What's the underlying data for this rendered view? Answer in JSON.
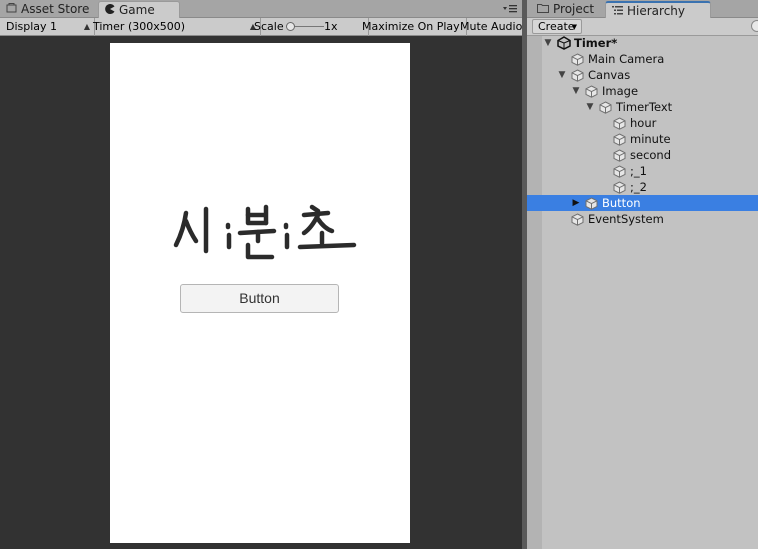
{
  "left_tabs": [
    {
      "label": "Asset Store",
      "icon": "store-icon"
    },
    {
      "label": "Game",
      "icon": "game-pacman-icon"
    }
  ],
  "right_tabs": [
    {
      "label": "Project",
      "icon": "folder-icon"
    },
    {
      "label": "Hierarchy",
      "icon": "list-icon"
    }
  ],
  "game_toolbar": {
    "display": "Display 1",
    "resolution": "Timer (300x500)",
    "scale_label": "Scale",
    "scale_value": "1x",
    "maximize": "Maximize On Play",
    "mute": "Mute Audio"
  },
  "game_view": {
    "button_label": "Button",
    "handwritten_text": "시:분:초"
  },
  "hierarchy": {
    "create_label": "Create",
    "items": [
      {
        "label": "Timer*"
      },
      {
        "label": "Main Camera"
      },
      {
        "label": "Canvas"
      },
      {
        "label": "Image"
      },
      {
        "label": "TimerText"
      },
      {
        "label": "hour"
      },
      {
        "label": "minute"
      },
      {
        "label": "second"
      },
      {
        "label": ";_1"
      },
      {
        "label": ";_2"
      },
      {
        "label": "Button"
      },
      {
        "label": "EventSystem"
      }
    ]
  },
  "colors": {
    "selection": "#3a7fe2",
    "game_bg": "#323232",
    "panel_bg": "#c2c2c2"
  }
}
